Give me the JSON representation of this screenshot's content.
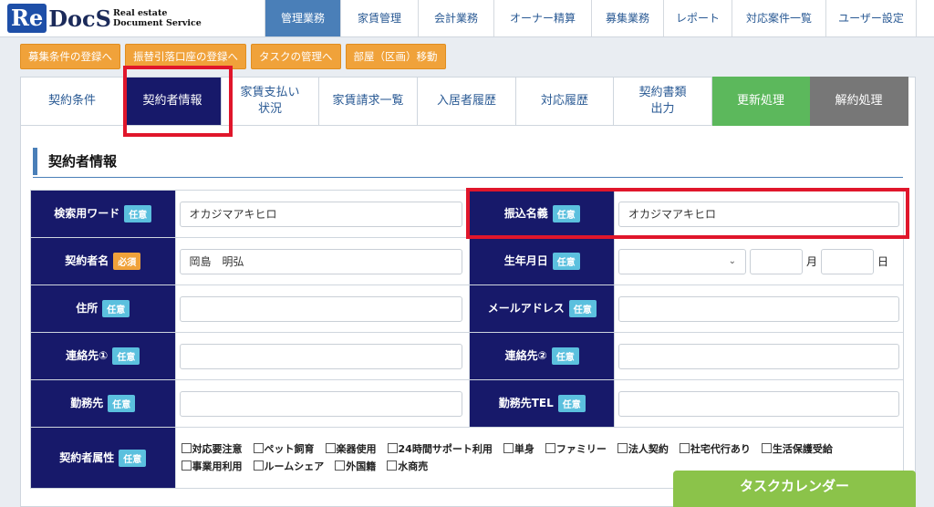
{
  "logo": {
    "re": "Re",
    "docs": "DocS",
    "sub1": "Real estate",
    "sub2": "Document Service"
  },
  "topnav": [
    "管理業務",
    "家賃管理",
    "会計業務",
    "オーナー精算",
    "募集業務",
    "レポート",
    "対応案件一覧",
    "ユーザー設定"
  ],
  "actions": [
    "募集条件の登録へ",
    "振替引落口座の登録へ",
    "タスクの管理へ",
    "部屋（区画）移動"
  ],
  "tabs": [
    {
      "l1": "契約条件",
      "l2": ""
    },
    {
      "l1": "契約者情報",
      "l2": ""
    },
    {
      "l1": "家賃支払い",
      "l2": "状況"
    },
    {
      "l1": "家賃請求一覧",
      "l2": ""
    },
    {
      "l1": "入居者履歴",
      "l2": ""
    },
    {
      "l1": "対応履歴",
      "l2": ""
    },
    {
      "l1": "契約書類",
      "l2": "出力"
    },
    {
      "l1": "更新処理",
      "l2": ""
    },
    {
      "l1": "解約処理",
      "l2": ""
    }
  ],
  "section_title": "契約者情報",
  "badges": {
    "optional": "任意",
    "required": "必須"
  },
  "fields": {
    "search_word": {
      "label": "検索用ワード",
      "value": "オカジマアキヒロ"
    },
    "transfer_name": {
      "label": "振込名義",
      "value": "オカジマアキヒロ"
    },
    "contractor_name": {
      "label": "契約者名",
      "value": "岡島　明弘"
    },
    "birth_date": {
      "label": "生年月日",
      "month_unit": "月",
      "day_unit": "日"
    },
    "address": {
      "label": "住所",
      "value": ""
    },
    "email": {
      "label": "メールアドレス",
      "value": ""
    },
    "contact1": {
      "label": "連絡先①",
      "value": ""
    },
    "contact2": {
      "label": "連絡先②",
      "value": ""
    },
    "workplace": {
      "label": "勤務先",
      "value": ""
    },
    "workplace_tel": {
      "label": "勤務先TEL",
      "value": ""
    },
    "attributes": {
      "label": "契約者属性",
      "options": [
        "対応要注意",
        "ペット飼育",
        "楽器使用",
        "24時間サポート利用",
        "単身",
        "ファミリー",
        "法人契約",
        "社宅代行あり",
        "生活保護受給",
        "事業用利用",
        "ルームシェア",
        "外国籍",
        "水商売"
      ]
    }
  },
  "task_calendar": "タスクカレンダー",
  "colors": {
    "navy": "#17196a",
    "highlight": "#e0162b",
    "accent": "#4a7fb8",
    "orange": "#f0a23a",
    "green": "#5cb85c"
  }
}
